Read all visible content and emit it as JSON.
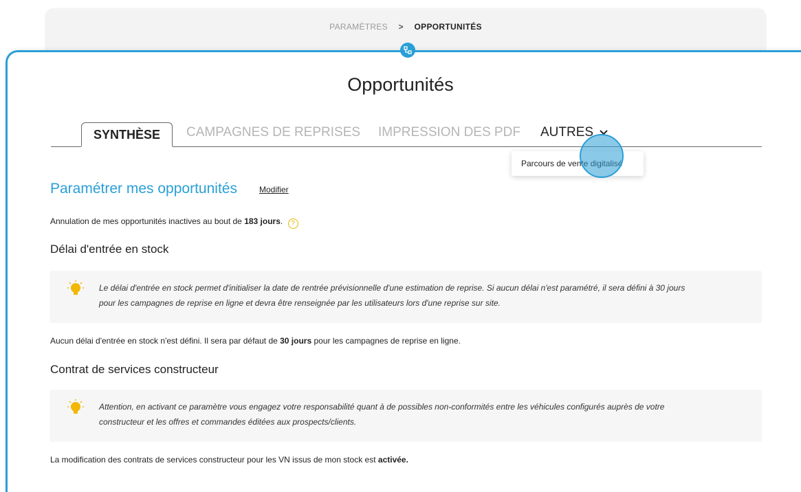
{
  "breadcrumb": {
    "parent": "PARAMÈTRES",
    "separator": ">",
    "current": "OPPORTUNITÉS"
  },
  "page_title": "Opportunités",
  "tabs": [
    {
      "label": "SYNTHÈSE",
      "active": true
    },
    {
      "label": "CAMPAGNES DE REPRISES",
      "active": false
    },
    {
      "label": "IMPRESSION DES PDF",
      "active": false
    },
    {
      "label": "AUTRES",
      "active": false
    }
  ],
  "dropdown": {
    "items": [
      "Parcours de vente digitalisé"
    ]
  },
  "section": {
    "title": "Paramétrer mes opportunités",
    "modify_label": "Modifier",
    "inactive_prefix": "Annulation de mes opportunités inactives au bout de ",
    "inactive_value": "183 jours",
    "inactive_suffix": "."
  },
  "stock": {
    "heading": "Délai d'entrée en stock",
    "info_line1": "Le délai d'entrée en stock permet d'initialiser la date de rentrée prévisionnelle d'une estimation de reprise. Si aucun délai n'est paramétré, il sera défini à 30 jours",
    "info_line2": "pour les campagnes de reprise en ligne et devra être renseignée par les utilisateurs lors d'une reprise sur site.",
    "status_prefix": "Aucun délai d'entrée en stock n'est défini. Il sera par défaut de ",
    "status_value": "30 jours",
    "status_suffix": " pour les campagnes de reprise en ligne."
  },
  "contract": {
    "heading": "Contrat de services constructeur",
    "info_line1": "Attention, en activant ce paramètre vous engagez votre responsabilité quant à de possibles non-conformités entre les véhicules configurés auprès de votre",
    "info_line2": "constructeur et les offres et commandes éditées aux prospects/clients.",
    "status_prefix": "La modification des contrats de services constructeur pour les VN issus de mon stock est ",
    "status_value": "activée."
  },
  "colors": {
    "accent": "#2a9fd6",
    "bulb": "#f2b705"
  },
  "icons": [
    "connector-icon",
    "chevron-down-icon",
    "help-icon",
    "lightbulb-icon"
  ]
}
